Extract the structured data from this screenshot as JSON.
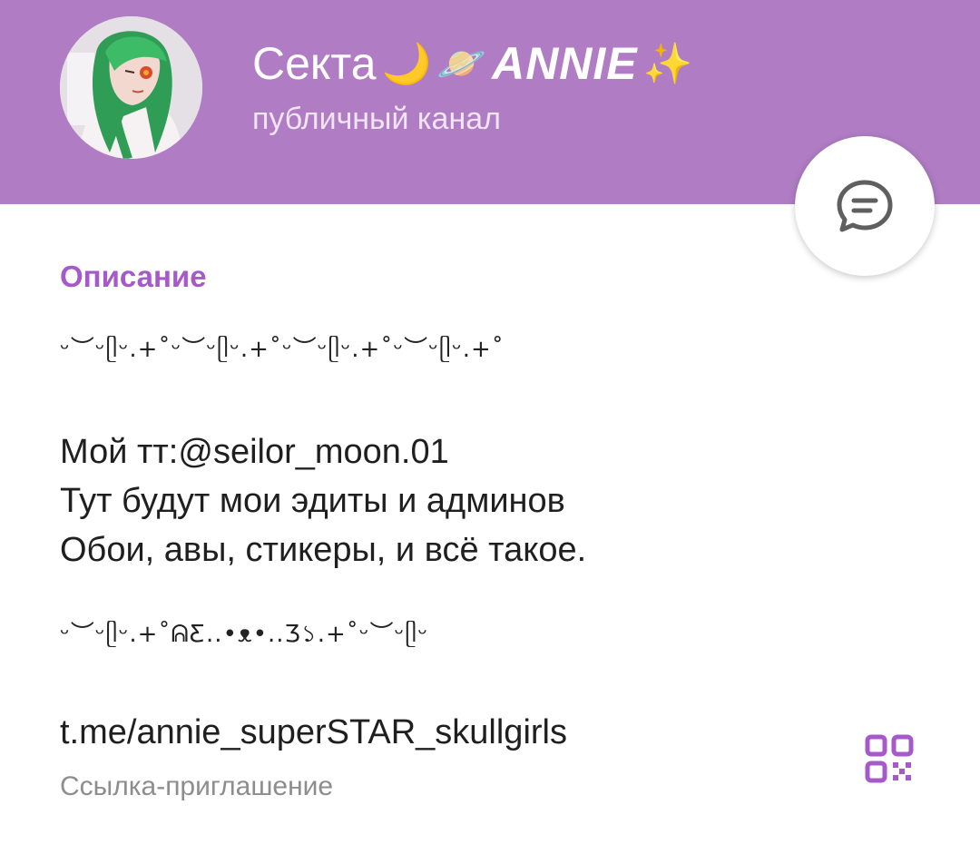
{
  "colors": {
    "header_bg": "#b07cc4",
    "accent": "#a65ac9",
    "secondary_text": "#8d8d8d"
  },
  "header": {
    "title_prefix": "Секта",
    "title_emoji_moon": "🌙",
    "title_emoji_planet": "🪐",
    "title_name": "ANNIE",
    "title_emoji_sparkles": "✨",
    "subtitle": "публичный канал",
    "avatar_icon": "avatar-image",
    "chat_icon": "chat-bubble-icon"
  },
  "description": {
    "section_title": "Описание",
    "deco_top": "ᵕ︶ᵕᥫᵕ.+˚ᵕ︶ᵕᥫᵕ.+˚ᵕ︶ᵕᥫᵕ.+˚ᵕ︶ᵕᥫᵕ.+˚",
    "lines": [
      "Мой тт:@seilor_moon.01",
      "Тут будут мои эдиты и админов",
      "Обои, авы, стикеры, и всё такое."
    ],
    "deco_bottom": "ᵕ︶ᵕᥫᵕ.+˚ᕱƸ..•ᴥ•..Ʒ১.+˚ᵕ︶ᵕᥫᵕ"
  },
  "invite": {
    "link": "t.me/annie_superSTAR_skullgirls",
    "label": "Ссылка-приглашение",
    "qr_icon": "qr-code-icon"
  }
}
